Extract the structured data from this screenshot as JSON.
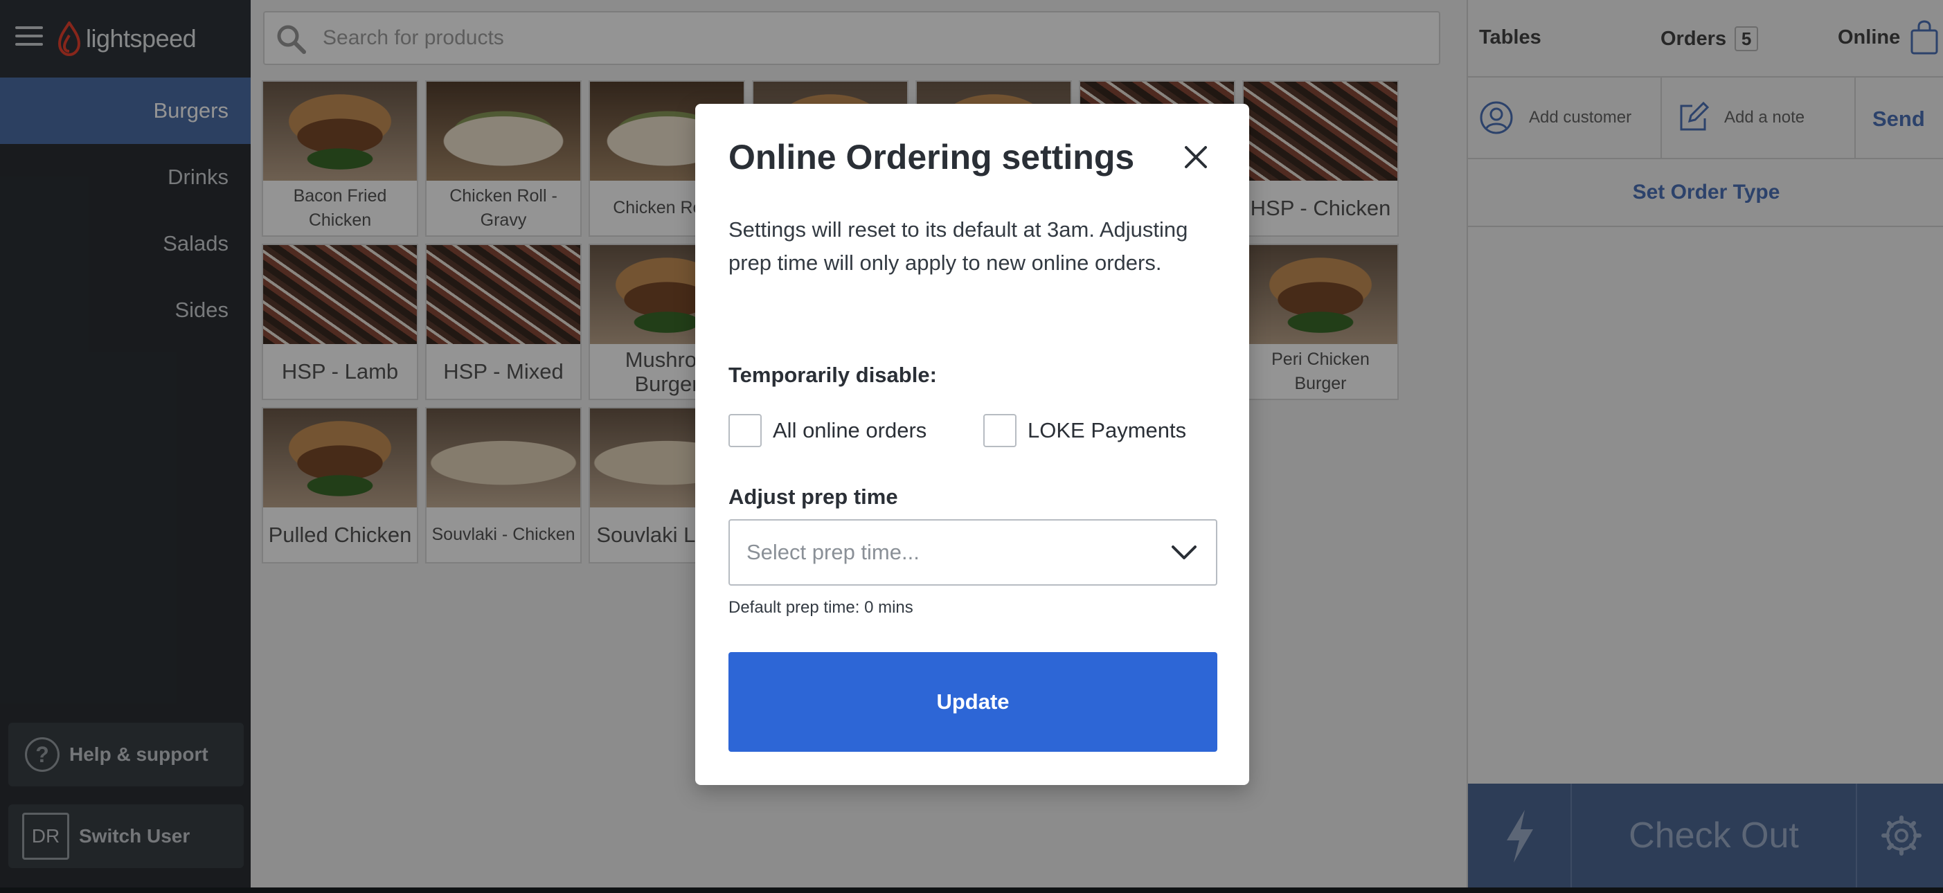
{
  "app": {
    "brand": "lightspeed"
  },
  "sidebar": {
    "categories": [
      "Burgers",
      "Drinks",
      "Salads",
      "Sides"
    ],
    "active_category": "Burgers",
    "help_label": "Help & support",
    "user_initials": "DR",
    "switch_user_label": "Switch User"
  },
  "search": {
    "placeholder": "Search for products"
  },
  "products": [
    {
      "name": "Bacon Fried Chicken",
      "image": "burger"
    },
    {
      "name": "Chicken Roll - Gravy",
      "image": "wrap"
    },
    {
      "name": "Chicken Roll -",
      "image": "wrap"
    },
    {
      "name": "",
      "image": "burger"
    },
    {
      "name": "",
      "image": "burger"
    },
    {
      "name": "",
      "image": "hsp"
    },
    {
      "name": "HSP - Chicken",
      "image": "hsp"
    },
    {
      "name": "HSP - Lamb",
      "image": "hsp"
    },
    {
      "name": "HSP - Mixed",
      "image": "hsp"
    },
    {
      "name": "Mushroo Burger",
      "image": "burger"
    },
    {
      "name": "Peri Chicken Burger",
      "image": "burger"
    },
    {
      "name": "Pulled Chicken",
      "image": "burger"
    },
    {
      "name": "Souvlaki - Chicken",
      "image": "souvlaki"
    },
    {
      "name": "Souvlaki Lamb",
      "image": "souvlaki"
    }
  ],
  "order_panel": {
    "tables_label": "Tables",
    "orders_label": "Orders",
    "orders_count": "5",
    "online_label": "Online",
    "add_customer_label": "Add customer",
    "add_note_label": "Add a note",
    "send_label": "Send",
    "order_type_label": "Set Order Type",
    "checkout_label": "Check Out"
  },
  "modal": {
    "title": "Online Ordering settings",
    "description": "Settings will reset to its default at 3am. Adjusting prep time will only apply to new online orders.",
    "disable_heading": "Temporarily disable:",
    "checkbox_all_orders": "All online orders",
    "checkbox_loke": "LOKE Payments",
    "prep_heading": "Adjust prep time",
    "prep_placeholder": "Select prep time...",
    "default_prep": "Default prep time: 0 mins",
    "update_label": "Update"
  },
  "colors": {
    "accent": "#2d66d6",
    "sidebar_active": "#4d6fa8",
    "link": "#4d72b8"
  },
  "icons": {
    "menu": "hamburger-icon",
    "search": "search-icon",
    "bag": "bag-icon",
    "customer": "user-circle-icon",
    "note": "edit-icon",
    "bolt": "lightning-icon",
    "settings": "gear-icon",
    "close": "close-icon",
    "dropdown": "chevron-down-icon"
  }
}
